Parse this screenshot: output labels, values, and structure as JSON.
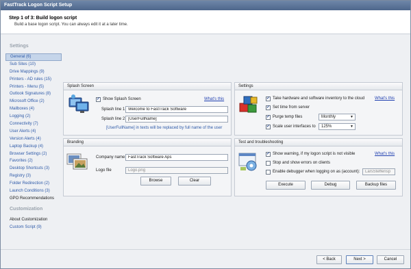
{
  "window": {
    "title": "FastTrack Logon Script Setup"
  },
  "header": {
    "step": "Step 1 of 3: Build logon script",
    "subtitle": "Build a base logon script. You can always edit it at a later time."
  },
  "sidebar": {
    "settings_heading": "Settings",
    "items": [
      "General (6)",
      "Sub Sites (10)",
      "Drive Mappings (9)",
      "Printers - AD rules (15)",
      "Printers - Menu (5)",
      "Outlook Signatures (8)",
      "Microsoft Office (2)",
      "Mailboxes (4)",
      "Logging (2)",
      "Connectivity (7)",
      "User Alerts (4)",
      "Version Alerts (4)",
      "Laptop Backup (4)",
      "Browser Settings (2)",
      "Favorites (2)",
      "Desktop Shortcuts (3)",
      "Registry (3)",
      "Folder Redirection (2)",
      "Launch Conditions (3)",
      "GPO Recommendations"
    ],
    "customization_heading": "Customization",
    "customization_items": [
      "About Customization",
      "Custom Script (9)"
    ]
  },
  "splash": {
    "title": "Splash Screen",
    "show_label": "Show Splash Screen",
    "whats_this": "What's this",
    "line1_label": "Splash line 1",
    "line1_value": "Welcome to FastTrack Software",
    "line2_label": "Splash line 2",
    "line2_value": "[UserFullName]",
    "info": "[UserFullName] in texts will be replaced by full name of the user"
  },
  "settings_panel": {
    "title": "Settings",
    "inventory_label": "Take hardware and software inventory to the cloud",
    "whats_this": "What's this",
    "time_label": "Set time from server",
    "purge_label": "Purge temp files",
    "purge_value": "Monthly",
    "scale_label": "Scale user interfaces to",
    "scale_value": "125%"
  },
  "branding": {
    "title": "Branding",
    "company_label": "Company name",
    "company_value": "FastTrack Software Aps",
    "logo_label": "Logo file",
    "logo_value": "Logo.png",
    "browse": "Browse",
    "clear": "Clear"
  },
  "test": {
    "title": "Test and troubleshooting",
    "warn_label": "Show warning, if my logon script is not visible",
    "whats_this": "What's this",
    "stop_label": "Stop and show errors on clients",
    "debug_label": "Enable debugger when logging on as (account):",
    "debug_account": "LarsSteffensp",
    "execute": "Execute",
    "debug": "Debug",
    "backup": "Backup files"
  },
  "footer": {
    "back": "< Back",
    "next": "Next >",
    "cancel": "Cancel"
  },
  "colors": {
    "accent": "#2e5aa8",
    "link": "#1f3fb0",
    "titlebar": "#4e678c"
  }
}
